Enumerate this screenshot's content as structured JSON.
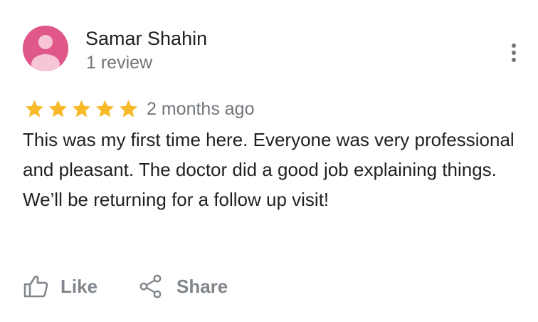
{
  "review": {
    "author_name": "Samar Shahin",
    "author_meta": "1 review",
    "rating": 5,
    "rating_max": 5,
    "time_ago": "2 months ago",
    "text": "This was my first time here. Everyone was very professional and pleasant. The doctor did a good job explaining things. We’ll be returning for a follow up visit!"
  },
  "actions": {
    "like_label": "Like",
    "share_label": "Share"
  },
  "icons": {
    "avatar": "person-icon",
    "more": "more-vert-icon",
    "star": "star-icon",
    "like": "thumb-up-icon",
    "share": "share-icon"
  },
  "colors": {
    "avatar_bg": "#e0578a",
    "star": "#f7b928",
    "secondary_text": "#70757a",
    "action_text": "#80868b"
  }
}
